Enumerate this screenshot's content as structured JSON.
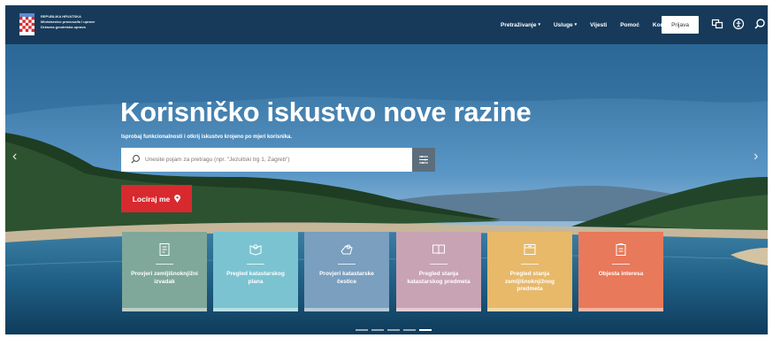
{
  "header": {
    "org_lines": [
      "REPUBLIKA HRVATSKA",
      "Ministarstvo pravosuđa i uprave",
      "Državna geodetska uprava"
    ],
    "nav": [
      {
        "label": "Pretraživanje",
        "has_dropdown": true
      },
      {
        "label": "Usluge",
        "has_dropdown": true
      },
      {
        "label": "Vijesti",
        "has_dropdown": false
      },
      {
        "label": "Pomoć",
        "has_dropdown": false
      },
      {
        "label": "Kontakt",
        "has_dropdown": false
      }
    ],
    "login_label": "Prijava",
    "icons": [
      "language-icon",
      "accessibility-icon",
      "search-icon"
    ]
  },
  "hero": {
    "headline": "Korisničko iskustvo nove razine",
    "subline": "Isprobaj funkcionalnosti i otkrij iskustvo krojeno po mjeri korisnika.",
    "search_placeholder": "Unesite pojam za pretragu (npr. \"Jezuitski trg 1, Zagreb\")",
    "locate_label": "Lociraj me",
    "carousel_count": 5,
    "carousel_active": 5
  },
  "tiles": [
    {
      "label": "Provjeri zemljišnoknjižni izvadak",
      "color": "#7fa89a",
      "icon": "document-icon"
    },
    {
      "label": "Pregled katastarskog plana",
      "color": "#7cc3d1",
      "icon": "map-pin-icon"
    },
    {
      "label": "Provjeri katastarske čestice",
      "color": "#7a9fbf",
      "icon": "parcel-icon"
    },
    {
      "label": "Pregled stanja katastarskog predmeta",
      "color": "#c8a3b4",
      "icon": "book-icon"
    },
    {
      "label": "Pregled stanja zemljišnoknjižnog predmeta",
      "color": "#e7b969",
      "icon": "folder-icon"
    },
    {
      "label": "Objesta interesa",
      "color": "#e8795a",
      "icon": "clipboard-icon"
    }
  ],
  "colors": {
    "header": "#173a5a",
    "locate": "#d8292f",
    "filter": "#5c6e7c"
  }
}
